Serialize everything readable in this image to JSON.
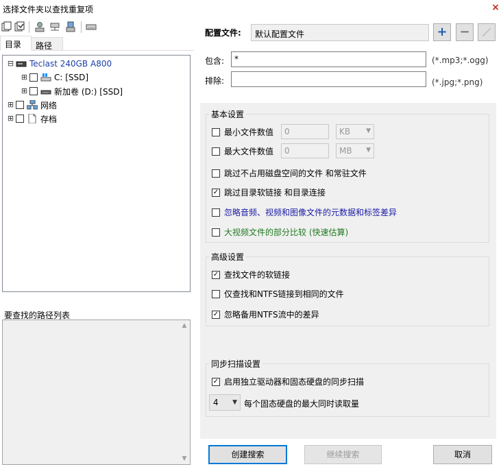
{
  "window": {
    "title": "选择文件夹以查找重复项",
    "close_glyph": "×"
  },
  "tabs": [
    {
      "label": "目录"
    },
    {
      "label": "路径"
    }
  ],
  "tree": [
    {
      "label": "Teclast 240GB A800",
      "expander": "⊟"
    },
    {
      "label": "C: [SSD]",
      "expander": "⊞"
    },
    {
      "label": "新加卷 (D:) [SSD]",
      "expander": "⊞"
    },
    {
      "label": "网络",
      "expander": "⊞"
    },
    {
      "label": "存档",
      "expander": "⊞"
    }
  ],
  "paths_panel": {
    "label": "要查找的路径列表"
  },
  "profile": {
    "label": "配置文件:",
    "value": "默认配置文件"
  },
  "include": {
    "label": "包含:",
    "value": "*",
    "hint": "(*.mp3;*.ogg)"
  },
  "exclude": {
    "label": "排除:",
    "value": "",
    "hint": "(*.jpg;*.png)"
  },
  "basic": {
    "title": "基本设置",
    "min_size": {
      "label": "最小文件数值",
      "value": "0",
      "unit": "KB",
      "checked": false
    },
    "max_size": {
      "label": "最大文件数值",
      "value": "0",
      "unit": "MB",
      "checked": false
    },
    "skip_sparse": {
      "label": "跳过不占用磁盘空间的文件 和常驻文件",
      "checked": false
    },
    "skip_links": {
      "label": "跳过目录软链接 和目录连接",
      "checked": true
    },
    "ignore_meta": {
      "label": "忽略音频、视频和图像文件的元数据和标签差异",
      "checked": false,
      "color": "#1a1aa6"
    },
    "partial_video": {
      "label": "大视频文件的部分比较 (快速估算)",
      "checked": false,
      "color": "#1f7a1f"
    }
  },
  "advanced": {
    "title": "高级设置",
    "find_symlinks": {
      "label": "查找文件的软链接",
      "checked": true
    },
    "ntfs_only": {
      "label": "仅查找和NTFS链接到相同的文件",
      "checked": false
    },
    "ignore_ads": {
      "label": "忽略备用NTFS流中的差异",
      "checked": true
    }
  },
  "sync": {
    "title": "同步扫描设置",
    "enable_sync": {
      "label": "启用独立驱动器和固态硬盘的同步扫描",
      "checked": true
    },
    "max_reads": {
      "value": "4",
      "label": "每个固态硬盘的最大同时读取量"
    }
  },
  "buttons": {
    "create": "创建搜索",
    "continue": "继续搜索",
    "cancel": "取消"
  },
  "check_glyph": "✓"
}
